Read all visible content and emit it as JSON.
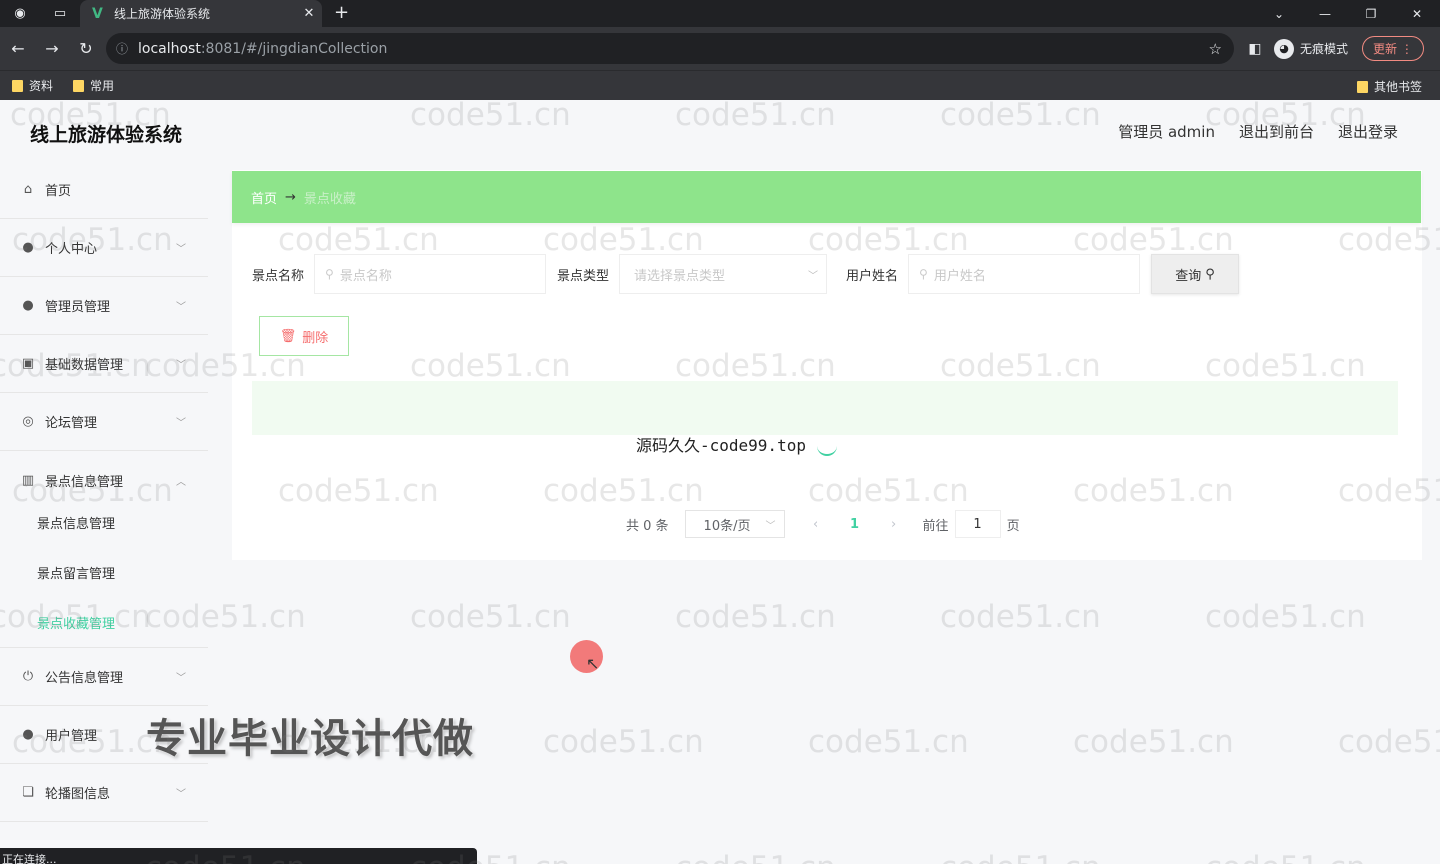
{
  "browser": {
    "tab_title": "线上旅游体验系统",
    "tab_logo": "V",
    "url_host": "localhost",
    "url_rest": ":8081/#/jingdianCollection",
    "profile_label": "无痕模式",
    "update_label": "更新",
    "bookmarks": [
      "资料",
      "常用"
    ],
    "other_bookmarks": "其他书签"
  },
  "app": {
    "title": "线上旅游体验系统",
    "header_links": [
      "管理员 admin",
      "退出到前台",
      "退出登录"
    ]
  },
  "sidebar": {
    "items": [
      {
        "label": "首页",
        "icon": "home-icon"
      },
      {
        "label": "个人中心",
        "icon": "user-icon"
      },
      {
        "label": "管理员管理",
        "icon": "admin-icon"
      },
      {
        "label": "基础数据管理",
        "icon": "data-icon"
      },
      {
        "label": "论坛管理",
        "icon": "forum-icon"
      },
      {
        "label": "景点信息管理",
        "icon": "chart-icon"
      }
    ],
    "sub_items": [
      "景点信息管理",
      "景点留言管理",
      "景点收藏管理"
    ],
    "items_after": [
      {
        "label": "公告信息管理",
        "icon": "power-icon"
      },
      {
        "label": "用户管理",
        "icon": "user-icon"
      },
      {
        "label": "轮播图信息",
        "icon": "copy-icon"
      }
    ]
  },
  "breadcrumb": {
    "home": "首页",
    "arrow": "→",
    "current": "景点收藏"
  },
  "search": {
    "name_label": "景点名称",
    "name_placeholder": "景点名称",
    "type_label": "景点类型",
    "type_placeholder": "请选择景点类型",
    "user_label": "用户姓名",
    "user_placeholder": "用户姓名",
    "query_label": "查询"
  },
  "actions": {
    "delete_label": "删除"
  },
  "table": {
    "overlay_text": "源码久久-code99.top"
  },
  "pagination": {
    "total": "共 0 条",
    "page_size": "10条/页",
    "current_page": "1",
    "goto_label": "前往",
    "goto_value": "1",
    "page_suffix": "页"
  },
  "overlay": {
    "promo": "专业毕业设计代做",
    "status": "正在连接..."
  },
  "watermark": "code51.cn",
  "colors": {
    "breadcrumb_bg": "#8ee48b",
    "accent": "#41d1a2",
    "danger": "#f56c6c"
  }
}
